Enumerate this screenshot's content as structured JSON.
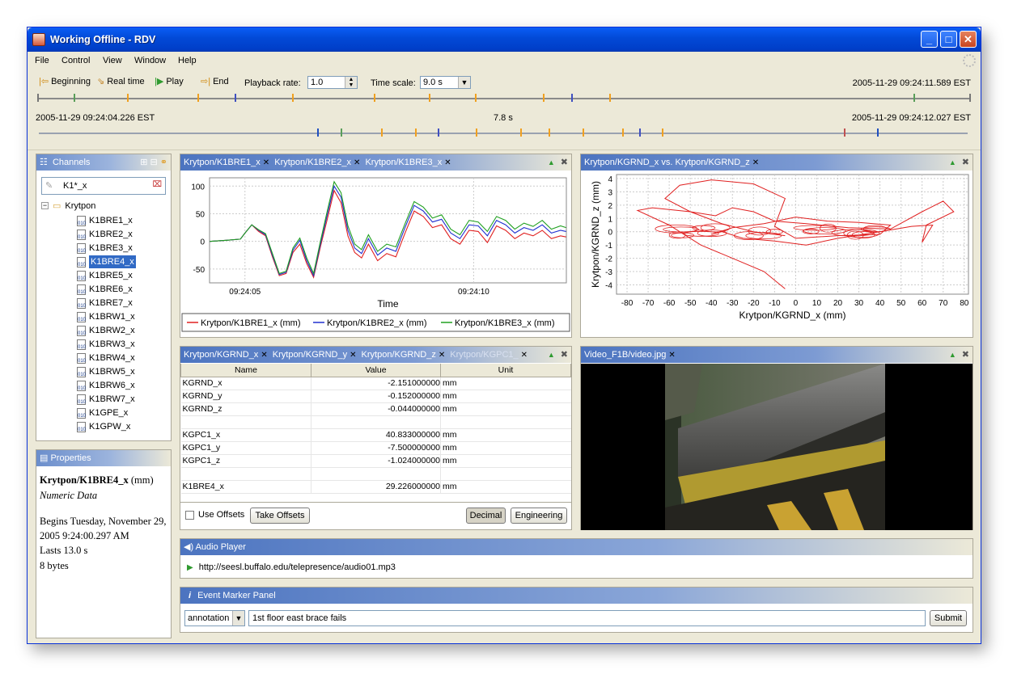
{
  "window": {
    "title": "Working Offline - RDV"
  },
  "menu": [
    "File",
    "Control",
    "View",
    "Window",
    "Help"
  ],
  "toolbar": {
    "beginning": "Beginning",
    "realtime": "Real time",
    "play": "Play",
    "end": "End",
    "rate_label": "Playback rate:",
    "rate_value": "1.0",
    "scale_label": "Time scale:",
    "scale_value": "9.0 s",
    "end_time_top": "2005-11-29 09:24:11.589 EST",
    "start_time": "2005-11-29 09:24:04.226 EST",
    "span": "7.8 s",
    "end_time": "2005-11-29 09:24:12.027 EST"
  },
  "channels": {
    "title": "Channels",
    "filter": "K1*_x",
    "root": "Krytpon",
    "items": [
      "K1BRE1_x",
      "K1BRE2_x",
      "K1BRE3_x",
      "K1BRE4_x",
      "K1BRE5_x",
      "K1BRE6_x",
      "K1BRE7_x",
      "K1BRW1_x",
      "K1BRW2_x",
      "K1BRW3_x",
      "K1BRW4_x",
      "K1BRW5_x",
      "K1BRW6_x",
      "K1BRW7_x",
      "K1GPE_x",
      "K1GPW_x"
    ],
    "selected": "K1BRE4_x"
  },
  "properties": {
    "title": "Properties",
    "name": "Krytpon/K1BRE4_x",
    "unit": "(mm)",
    "type": "Numeric Data",
    "begins": "Begins Tuesday, November 29, 2005 9:24:00.297 AM",
    "lasts": "Lasts 13.0 s",
    "size": "8 bytes"
  },
  "plot1": {
    "tabs": [
      "Krytpon/K1BRE1_x",
      "Krytpon/K1BRE2_x",
      "Krytpon/K1BRE3_x"
    ],
    "legend": [
      "Krytpon/K1BRE1_x (mm)",
      "Krytpon/K1BRE2_x (mm)",
      "Krytpon/K1BRE3_x (mm)"
    ],
    "colors": [
      "#e02020",
      "#2030d0",
      "#20a020"
    ]
  },
  "xy": {
    "tab": "Krytpon/KGRND_x vs. Krytpon/KGRND_z"
  },
  "table": {
    "tabs": [
      "Krytpon/KGRND_x",
      "Krytpon/KGRND_y",
      "Krytpon/KGRND_z",
      "Krytpon/KGPC1_"
    ],
    "headers": [
      "Name",
      "Value",
      "Unit"
    ],
    "rows": [
      [
        "KGRND_x",
        "-2.151000000",
        "mm"
      ],
      [
        "KGRND_y",
        "-0.152000000",
        "mm"
      ],
      [
        "KGRND_z",
        "-0.044000000",
        "mm"
      ],
      [
        "",
        "",
        ""
      ],
      [
        "KGPC1_x",
        "40.833000000",
        "mm"
      ],
      [
        "KGPC1_y",
        "-7.500000000",
        "mm"
      ],
      [
        "KGPC1_z",
        "-1.024000000",
        "mm"
      ],
      [
        "",
        "",
        ""
      ],
      [
        "K1BRE4_x",
        "29.226000000",
        "mm"
      ]
    ],
    "use_offsets": "Use Offsets",
    "take_offsets": "Take Offsets",
    "decimal": "Decimal",
    "engineering": "Engineering"
  },
  "video": {
    "tab": "Video_F1B/video.jpg"
  },
  "audio": {
    "title": "Audio Player",
    "url": "http://seesl.buffalo.edu/telepresence/audio01.mp3"
  },
  "events": {
    "title": "Event Marker Panel",
    "type": "annotation",
    "text": "1st floor east brace fails",
    "submit": "Submit"
  },
  "chart_data": [
    {
      "type": "line",
      "xlabel": "Time",
      "ylabel": "",
      "ylim": [
        -75,
        115
      ],
      "xticks": [
        "09:24:05",
        "09:24:10"
      ],
      "yticks": [
        100,
        50,
        0,
        -50
      ],
      "x_range_s": [
        4.226,
        12.027
      ],
      "series": [
        {
          "name": "Krytpon/K1BRE1_x (mm)",
          "x": [
            4.23,
            4.6,
            4.9,
            5.0,
            5.15,
            5.3,
            5.45,
            5.6,
            5.75,
            5.9,
            6.05,
            6.2,
            6.35,
            6.5,
            6.65,
            6.8,
            6.95,
            7.1,
            7.25,
            7.4,
            7.55,
            7.7,
            7.9,
            8.1,
            8.3,
            8.5,
            8.7,
            8.9,
            9.1,
            9.3,
            9.5,
            9.7,
            9.9,
            10.1,
            10.3,
            10.5,
            10.7,
            10.9,
            11.1,
            11.3,
            11.5,
            11.7,
            11.9,
            12.02
          ],
          "values": [
            0,
            2,
            4,
            15,
            30,
            18,
            10,
            -28,
            -62,
            -58,
            -20,
            -5,
            -40,
            -65,
            -10,
            40,
            92,
            70,
            10,
            -20,
            -30,
            -5,
            -35,
            -22,
            -28,
            15,
            55,
            45,
            25,
            30,
            5,
            -5,
            20,
            18,
            -2,
            28,
            20,
            5,
            15,
            10,
            20,
            5,
            10,
            8
          ]
        },
        {
          "name": "Krytpon/K1BRE2_x (mm)",
          "x": [
            4.23,
            4.6,
            4.9,
            5.0,
            5.15,
            5.3,
            5.45,
            5.6,
            5.75,
            5.9,
            6.05,
            6.2,
            6.35,
            6.5,
            6.65,
            6.8,
            6.95,
            7.1,
            7.25,
            7.4,
            7.55,
            7.7,
            7.9,
            8.1,
            8.3,
            8.5,
            8.7,
            8.9,
            9.1,
            9.3,
            9.5,
            9.7,
            9.9,
            10.1,
            10.3,
            10.5,
            10.7,
            10.9,
            11.1,
            11.3,
            11.5,
            11.7,
            11.9,
            12.02
          ],
          "values": [
            0,
            2,
            4,
            15,
            30,
            20,
            12,
            -25,
            -60,
            -56,
            -16,
            2,
            -35,
            -62,
            -5,
            48,
            100,
            80,
            20,
            -12,
            -22,
            5,
            -25,
            -12,
            -18,
            25,
            65,
            55,
            35,
            40,
            15,
            5,
            30,
            28,
            10,
            38,
            30,
            15,
            25,
            20,
            30,
            15,
            20,
            18
          ]
        },
        {
          "name": "Krytpon/K1BRE3_x (mm)",
          "x": [
            4.23,
            4.6,
            4.9,
            5.0,
            5.15,
            5.3,
            5.45,
            5.6,
            5.75,
            5.9,
            6.05,
            6.2,
            6.35,
            6.5,
            6.65,
            6.8,
            6.95,
            7.1,
            7.25,
            7.4,
            7.55,
            7.7,
            7.9,
            8.1,
            8.3,
            8.5,
            8.7,
            8.9,
            9.1,
            9.3,
            9.5,
            9.7,
            9.9,
            10.1,
            10.3,
            10.5,
            10.7,
            10.9,
            11.1,
            11.3,
            11.5,
            11.7,
            11.9,
            12.02
          ],
          "values": [
            0,
            2,
            4,
            15,
            30,
            21,
            14,
            -22,
            -58,
            -54,
            -12,
            6,
            -30,
            -58,
            0,
            55,
            108,
            88,
            28,
            -5,
            -15,
            12,
            -18,
            -5,
            -10,
            32,
            72,
            62,
            42,
            48,
            22,
            12,
            38,
            35,
            18,
            45,
            38,
            22,
            33,
            27,
            38,
            22,
            28,
            25
          ]
        }
      ]
    },
    {
      "type": "scatter",
      "title": "",
      "xlabel": "Krytpon/KGRND_x (mm)",
      "ylabel": "Krytpon/KGRND_z (mm)",
      "xlim": [
        -85,
        82
      ],
      "ylim": [
        -4.7,
        4.3
      ],
      "xticks": [
        -80,
        -70,
        -60,
        -50,
        -40,
        -30,
        -20,
        -10,
        0,
        10,
        20,
        30,
        40,
        50,
        60,
        70,
        80
      ],
      "yticks": [
        4,
        3,
        2,
        1,
        0,
        -1,
        -2,
        -3,
        -4
      ],
      "series": [
        {
          "name": "",
          "x": [
            -5,
            -15,
            -30,
            -45,
            -60,
            -75,
            -68,
            -50,
            -38,
            -30,
            -20,
            -10,
            5,
            25,
            45,
            60,
            70,
            75,
            62,
            60,
            65,
            55,
            40,
            20,
            5,
            -10,
            -25,
            -35,
            -40,
            -30,
            -15,
            0,
            15,
            30,
            45,
            40,
            20,
            0,
            -10,
            -5,
            -20,
            -40,
            -55,
            -62,
            -50,
            -35,
            -20,
            -5
          ],
          "y": [
            -4.3,
            -3,
            -2,
            -1,
            0.5,
            1.6,
            1.8,
            1.5,
            1.2,
            1.8,
            1.5,
            0.8,
            0.6,
            0.3,
            0.2,
            1.5,
            2.3,
            1.5,
            0.5,
            -0.8,
            0.5,
            0.4,
            0,
            -0.5,
            -1,
            -0.7,
            -0.5,
            0,
            -0.2,
            0.3,
            0.6,
            1.1,
            0.8,
            0.7,
            0.5,
            -0.2,
            -0.3,
            -0.5,
            0.4,
            2.5,
            3.6,
            3.9,
            3.5,
            2.5,
            1.5,
            0.6,
            0,
            -0.3
          ]
        }
      ]
    }
  ]
}
